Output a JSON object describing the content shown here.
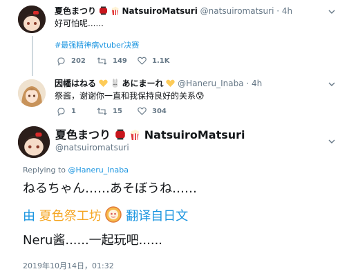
{
  "tweet1": {
    "name": "夏色まつり",
    "name_suffix": "NatsuiroMatsuri",
    "handle": "@natsuiromatsuri",
    "time": "· 4h",
    "text": "好可怕呢......",
    "hashtag": "#最强精神病vtuber决赛",
    "replies": "202",
    "retweets": "149",
    "likes": "1.1K"
  },
  "tweet2": {
    "name": "因幡はねる",
    "name_mid": "あにまーれ",
    "handle": "@Haneru_Inaba",
    "time": "· 4h",
    "text": "祭酱，谢谢你一直和我保持良好的关系😰",
    "replies": "1",
    "retweets": "15",
    "likes": "304"
  },
  "main": {
    "name": "夏色まつり",
    "name_suffix": "NatsuiroMatsuri",
    "handle": "@natsuiromatsuri",
    "replying_label": "Replying to",
    "replying_handle": "@Haneru_Inaba",
    "text": "ねるちゃん……あそぼうね……",
    "translation_prefix": "由",
    "translation_source": "夏色祭工坊",
    "translation_suffix": "翻译自日文",
    "translated_text": "Neru酱......一起玩吧......",
    "timestamp": "2019年10月14日，01:32"
  },
  "colors": {
    "link": "#1b95e0",
    "muted": "#657786",
    "text": "#14171a",
    "accent_orange": "#f5a623"
  },
  "icons": [
    "red-lantern-icon",
    "popcorn-icon",
    "rabbit-icon",
    "yellow-heart-icon",
    "chevron-down-icon",
    "reply-icon",
    "retweet-icon",
    "like-icon"
  ]
}
